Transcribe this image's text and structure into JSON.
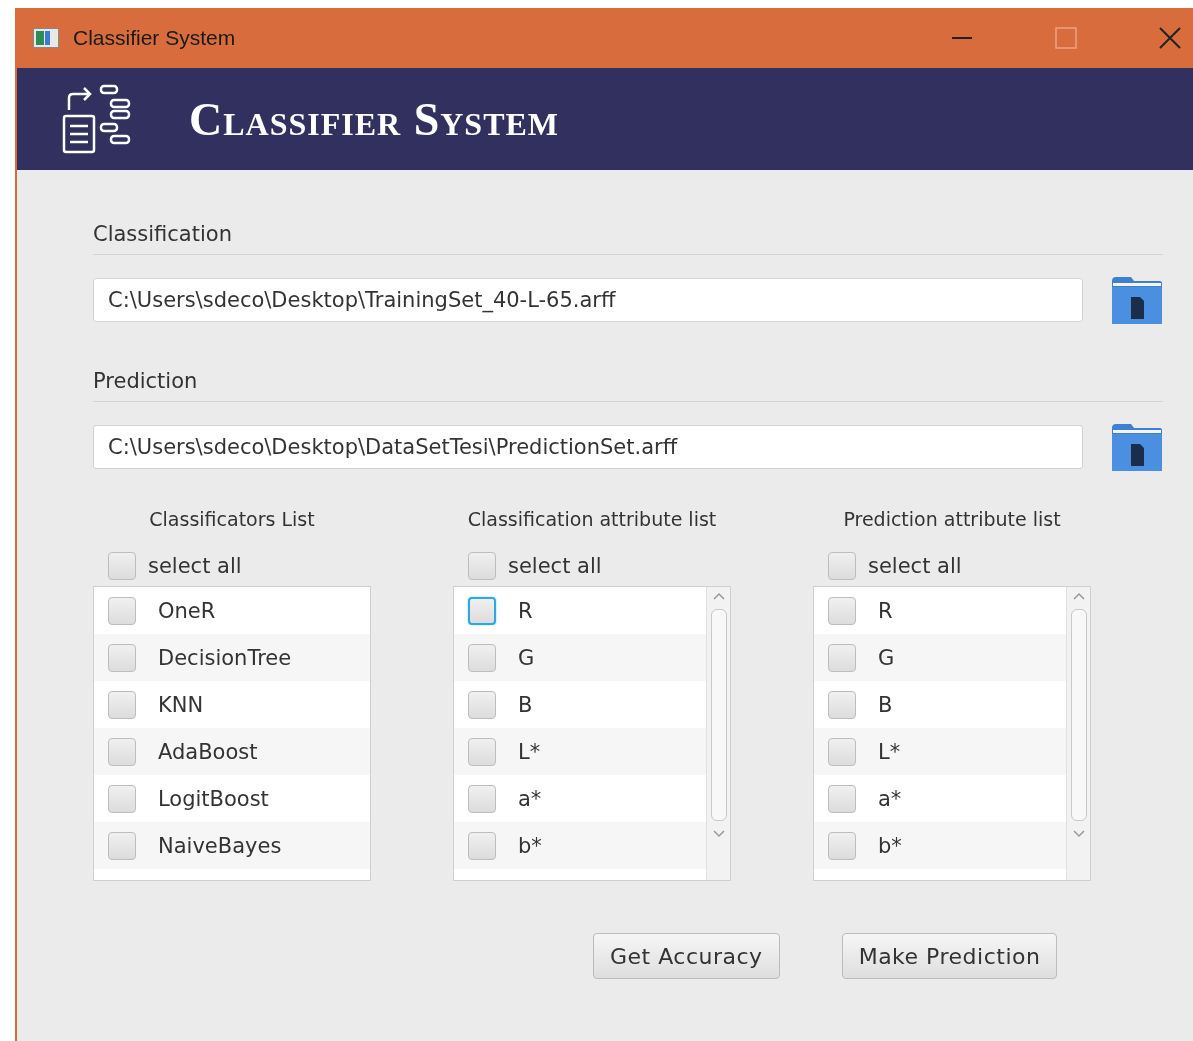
{
  "window": {
    "title": "Classifier System",
    "maximize_disabled": true
  },
  "header": {
    "title": "Classifier System"
  },
  "sections": [
    {
      "label": "Classification",
      "path": "C:\\Users\\sdeco\\Desktop\\TrainingSet_40-L-65.arff"
    },
    {
      "label": "Prediction",
      "path": "C:\\Users\\sdeco\\Desktop\\DataSetTesi\\PredictionSet.arff"
    }
  ],
  "lists": [
    {
      "title": "Classificators List",
      "select_all": {
        "label": "select all",
        "checked": false
      },
      "scrollbar": false,
      "items": [
        {
          "label": "OneR",
          "checked": false,
          "focused": false
        },
        {
          "label": "DecisionTree",
          "checked": false,
          "focused": false
        },
        {
          "label": "KNN",
          "checked": false,
          "focused": false
        },
        {
          "label": "AdaBoost",
          "checked": false,
          "focused": false
        },
        {
          "label": "LogitBoost",
          "checked": false,
          "focused": false
        },
        {
          "label": "NaiveBayes",
          "checked": false,
          "focused": false
        }
      ]
    },
    {
      "title": "Classification attribute list",
      "select_all": {
        "label": "select all",
        "checked": false
      },
      "scrollbar": true,
      "items": [
        {
          "label": "R",
          "checked": false,
          "focused": true
        },
        {
          "label": "G",
          "checked": false,
          "focused": false
        },
        {
          "label": "B",
          "checked": false,
          "focused": false
        },
        {
          "label": "L*",
          "checked": false,
          "focused": false
        },
        {
          "label": "a*",
          "checked": false,
          "focused": false
        },
        {
          "label": "b*",
          "checked": false,
          "focused": false
        }
      ]
    },
    {
      "title": "Prediction attribute list",
      "select_all": {
        "label": "select all",
        "checked": false
      },
      "scrollbar": true,
      "items": [
        {
          "label": "R",
          "checked": false,
          "focused": false
        },
        {
          "label": "G",
          "checked": false,
          "focused": false
        },
        {
          "label": "B",
          "checked": false,
          "focused": false
        },
        {
          "label": "L*",
          "checked": false,
          "focused": false
        },
        {
          "label": "a*",
          "checked": false,
          "focused": false
        },
        {
          "label": "b*",
          "checked": false,
          "focused": false
        }
      ]
    }
  ],
  "buttons": [
    "Get Accuracy",
    "Make Prediction"
  ]
}
